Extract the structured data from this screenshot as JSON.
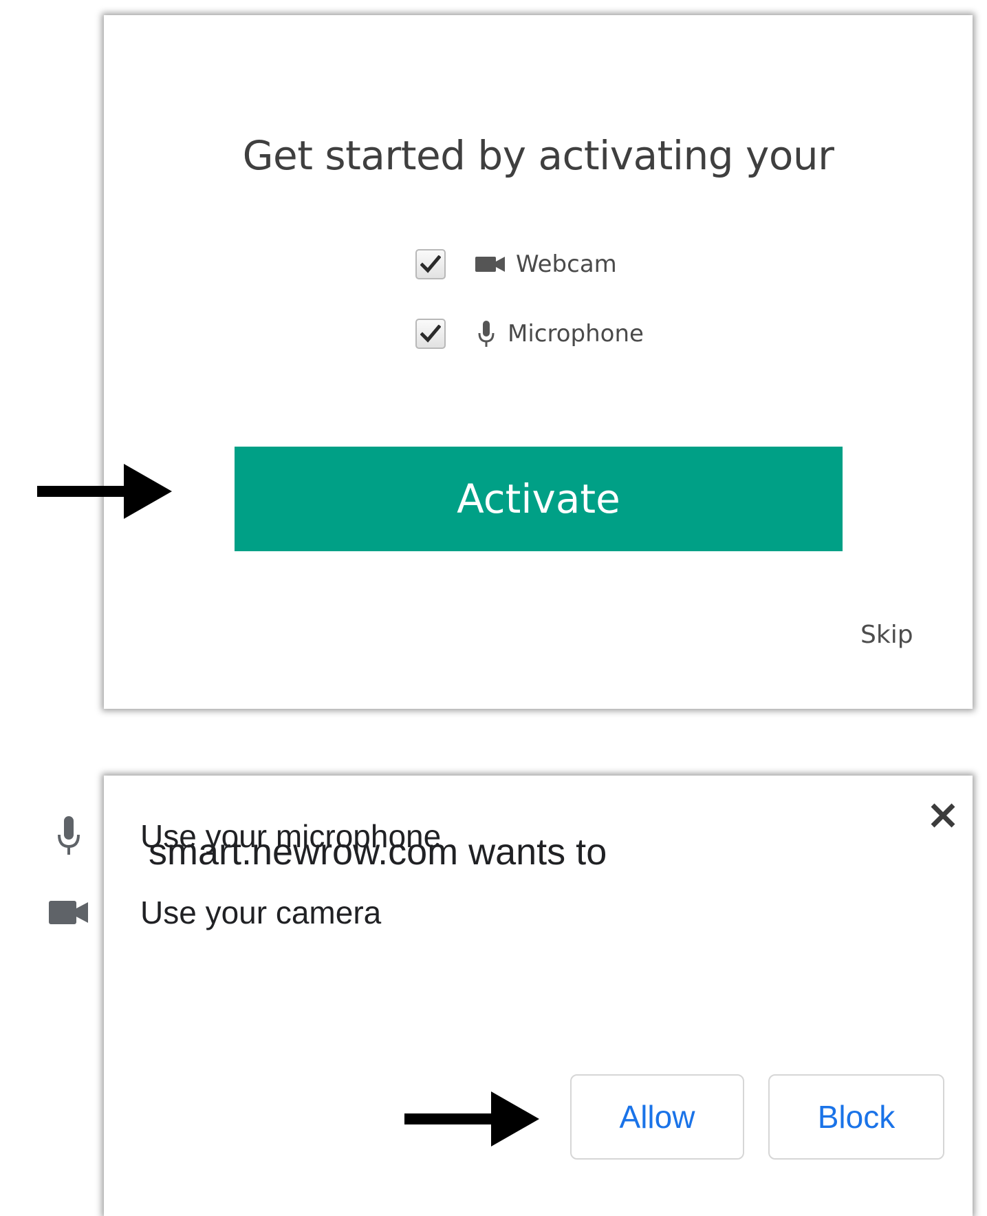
{
  "activation": {
    "title": "Get started by activating your",
    "options": [
      {
        "label": "Webcam",
        "icon": "video-camera-icon",
        "checked": true
      },
      {
        "label": "Microphone",
        "icon": "microphone-icon",
        "checked": true
      }
    ],
    "activate_label": "Activate",
    "skip_label": "Skip",
    "accent_color": "#00a086"
  },
  "permission_prompt": {
    "title": "smart.newrow.com wants to",
    "close_icon": "close-icon",
    "items": [
      {
        "label": "Use your microphone",
        "icon": "microphone-icon"
      },
      {
        "label": "Use your camera",
        "icon": "video-camera-icon"
      }
    ],
    "allow_label": "Allow",
    "block_label": "Block",
    "button_text_color": "#1a73e8"
  },
  "annotations": {
    "arrow_icon": "right-arrow-icon",
    "arrow_color": "#000000"
  }
}
